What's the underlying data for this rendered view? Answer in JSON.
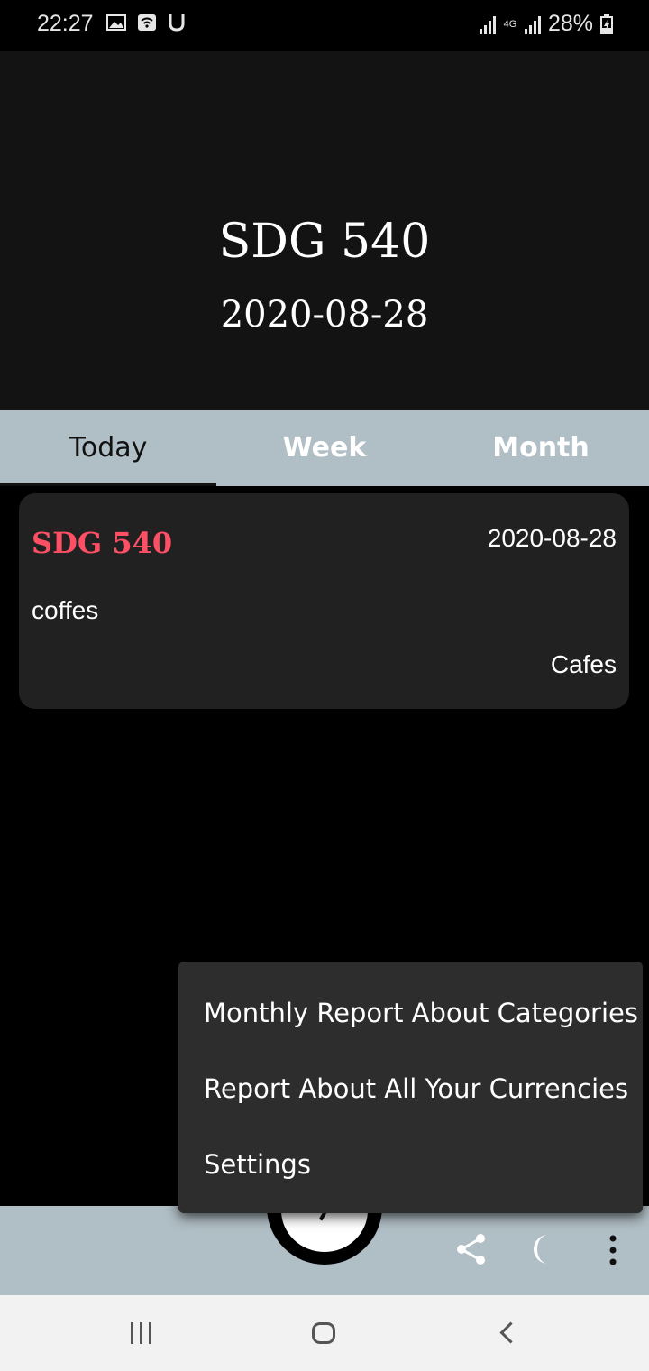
{
  "status_bar": {
    "time": "22:27",
    "left_icons": [
      "image-icon",
      "wifi-icon",
      "u-icon"
    ],
    "network_type": "4G",
    "battery": "28%"
  },
  "header": {
    "title": "SDG 540",
    "date": "2020-08-28"
  },
  "tabs": [
    {
      "label": "Today",
      "active": true
    },
    {
      "label": "Week",
      "active": false
    },
    {
      "label": "Month",
      "active": false
    }
  ],
  "entry": {
    "amount": "SDG 540",
    "date": "2020-08-28",
    "description": "coffes",
    "category": "Cafes",
    "amount_color": "#ff4f64"
  },
  "menu": {
    "items": [
      "Monthly Report About Categories",
      "Report About All Your Currencies",
      "Settings"
    ]
  },
  "bottom_bar": {
    "icons": [
      "share-icon",
      "moon-icon",
      "more-vert-icon"
    ],
    "fab_icon": "check-icon",
    "color": "#b0bec5"
  },
  "nav_bar": {
    "icons": [
      "recents-icon",
      "home-icon",
      "back-icon"
    ]
  }
}
